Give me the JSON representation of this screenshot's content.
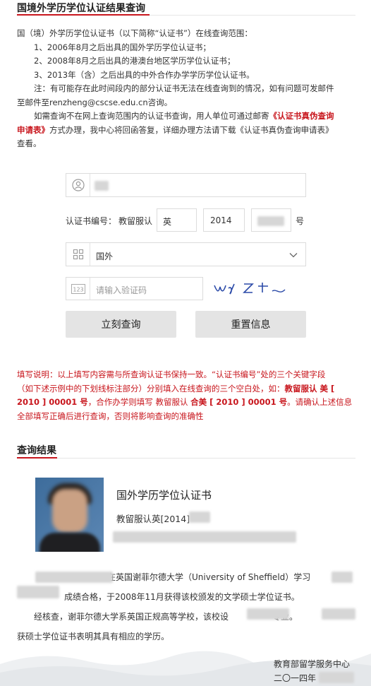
{
  "query_section": {
    "title": "国境外学历学位认证结果查询"
  },
  "intro": {
    "lead": "国（境）外学历学位认证书（以下简称“认证书”）在线查询范围：",
    "items": [
      "1、2006年8月之后出具的国外学历学位认证书；",
      "2、2008年8月之后出具的港澳台地区学历学位认证书；",
      "3、2013年（含）之后出具的中外合作办学学历学位认证书。"
    ],
    "note_line1": "注：有可能存在此时间段内的部分认证书无法在线查询到的情况，如有问题可发邮件",
    "note_line2": "至邮件至renzheng@cscse.edu.cn咨询。",
    "offline_a": "如需查询不在网上查询范围内的认证书查询，用人单位可通过邮寄",
    "offline_red1": "《认证书真伪查询",
    "offline_red2": "申请表》",
    "offline_b": "方式办理，我中心将回函答复，详细办理方法请下载《认证书真伪查询申请表》",
    "offline_c": "查看。"
  },
  "form": {
    "cert_label": "认证书编号：",
    "cert_prefix": "教留服认",
    "cert_field1": "英",
    "cert_field2": "2014",
    "cert_suffix": "号",
    "region_value": "国外",
    "captcha_placeholder": "请输入验证码",
    "captcha_text": "wJZt",
    "submit_label": "立刻查询",
    "reset_label": "重置信息"
  },
  "fill_note": {
    "line1a": "填写说明：以上填写内容需与所查询认证书保持一致。“认证书编号”处的三个关键字段",
    "line2a": "（如下述示例中的下划线标注部分）分别填入在线查询的三个空白处，如：",
    "example1": "教留服认 美 [",
    "line3a": "2010 ] 00001 号",
    "line3b": "，合作办学则填写 教留服认 ",
    "example2": "合美 [ 2010 ] 00001 号",
    "line3c": "。请确认上述信息",
    "line4": "全部填写正确后进行查询，否则将影响查询的准确性"
  },
  "result_section": {
    "title": "查询结果",
    "cert_title": "国外学历学位认证书",
    "cert_number": "教留服认英[2014]",
    "body_line1": "在英国谢菲尔德大学（University of Sheffield）学习",
    "body_line2": "成绩合格，于2008年11月获得该校颁发的文学硕士学位证书。",
    "body_line3a": "经核查，谢菲尔德大学系英国正规高等学校，该校设",
    "body_line3b": "专业。",
    "body_line4": "获硕士学位证书表明其具有相应的学历。",
    "issuer": "教育部留学服务中心",
    "date": "二〇一四年"
  },
  "colors": {
    "accent": "#c8161d",
    "button_bg": "#e4e4e4",
    "border": "#dcdcdc"
  },
  "icons": {
    "name_field": "user-badge-icon",
    "region_field": "grid-icon",
    "region_dropdown": "chevron-down-icon",
    "captcha_field": "number-123-icon"
  }
}
